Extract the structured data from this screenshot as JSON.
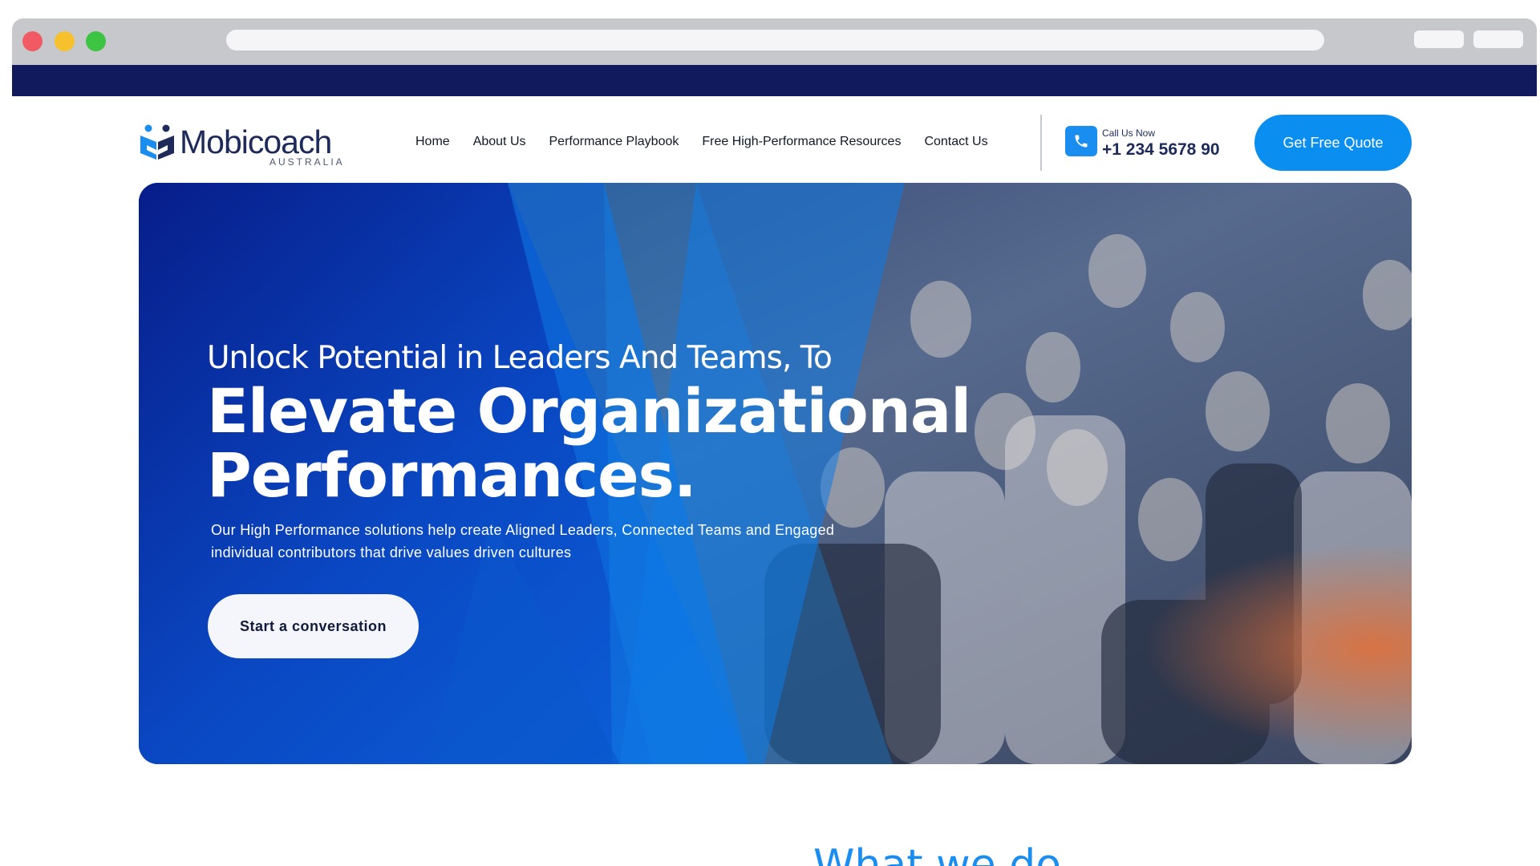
{
  "browser": {
    "controls": [
      "close",
      "minimize",
      "maximize"
    ]
  },
  "header": {
    "logo": {
      "name": "Mobicoach",
      "sub": "AUSTRALIA"
    },
    "nav": [
      {
        "label": "Home"
      },
      {
        "label": "About Us"
      },
      {
        "label": "Performance Playbook"
      },
      {
        "label": "Free High-Performance Resources"
      },
      {
        "label": "Contact Us"
      }
    ],
    "call_label": "Call Us Now",
    "phone": "+1 234 5678 90",
    "quote_button": "Get Free Quote"
  },
  "hero": {
    "kicker": "Unlock Potential in Leaders And Teams, To",
    "title_line1": "Elevate Organizational",
    "title_line2": "Performances.",
    "description": "Our High Performance solutions help create Aligned Leaders, Connected Teams and Engaged individual contributors that drive values driven cultures",
    "cta": "Start a conversation"
  },
  "next_section": {
    "heading_peek": "What we do"
  },
  "colors": {
    "top_stripe": "#101a5c",
    "brand_blue": "#0a8ff0",
    "hero_dark": "#0b2a8a",
    "navy_text": "#1d2a5a"
  }
}
